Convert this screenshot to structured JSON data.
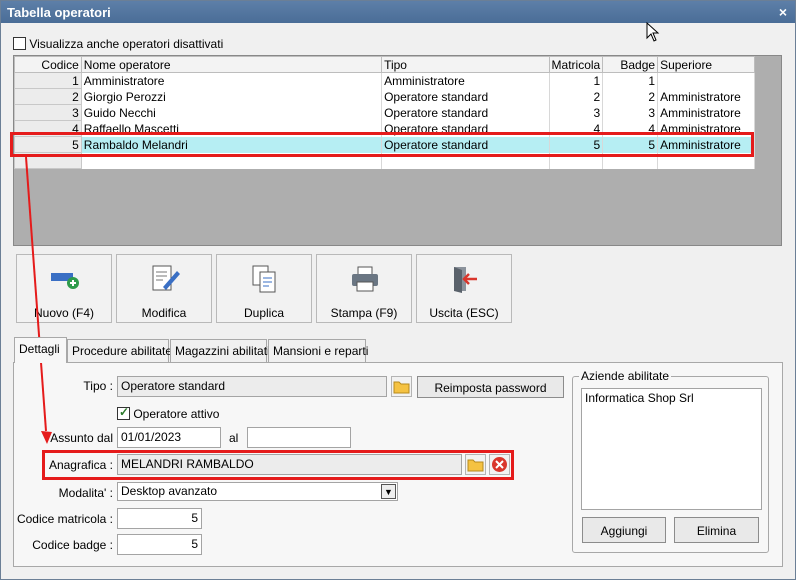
{
  "window": {
    "title": "Tabella operatori",
    "close_glyph": "×"
  },
  "show_disabled": {
    "label": "Visualizza anche operatori disattivati",
    "checked": false
  },
  "table": {
    "columns": [
      "Codice",
      "Nome operatore",
      "Tipo",
      "Matricola",
      "Badge",
      "Superiore"
    ],
    "rows": [
      {
        "codice": "1",
        "nome": "Amministratore",
        "tipo": "Amministratore",
        "matricola": "1",
        "badge": "1",
        "superiore": ""
      },
      {
        "codice": "2",
        "nome": "Giorgio Perozzi",
        "tipo": "Operatore standard",
        "matricola": "2",
        "badge": "2",
        "superiore": "Amministratore"
      },
      {
        "codice": "3",
        "nome": "Guido Necchi",
        "tipo": "Operatore standard",
        "matricola": "3",
        "badge": "3",
        "superiore": "Amministratore"
      },
      {
        "codice": "4",
        "nome": "Raffaello Mascetti",
        "tipo": "Operatore standard",
        "matricola": "4",
        "badge": "4",
        "superiore": "Amministratore"
      },
      {
        "codice": "5",
        "nome": "Rambaldo Melandri",
        "tipo": "Operatore standard",
        "matricola": "5",
        "badge": "5",
        "superiore": "Amministratore"
      }
    ],
    "selected_row": 5
  },
  "toolbar": {
    "nuovo": "Nuovo (F4)",
    "modifica": "Modifica",
    "duplica": "Duplica",
    "stampa": "Stampa (F9)",
    "uscita": "Uscita (ESC)"
  },
  "tabs": [
    "Dettagli",
    "Procedure abilitate",
    "Magazzini abilitati",
    "Mansioni e reparti"
  ],
  "details": {
    "tipo_label": "Tipo :",
    "tipo_value": "Operatore standard",
    "reset_password": "Reimposta password",
    "attivo_label": "Operatore attivo",
    "attivo_checked": true,
    "assunto_label": "Assunto dal",
    "assunto_value": "01/01/2023",
    "al_label": "al",
    "al_value": "",
    "anagrafica_label": "Anagrafica :",
    "anagrafica_value": "MELANDRI RAMBALDO",
    "modalita_label": "Modalita' :",
    "modalita_value": "Desktop avanzato",
    "matricola_label": "Codice matricola :",
    "matricola_value": "5",
    "badge_label": "Codice badge :",
    "badge_value": "5"
  },
  "aziende": {
    "title": "Aziende abilitate",
    "items": [
      "Informatica Shop Srl"
    ],
    "add": "Aggiungi",
    "remove": "Elimina"
  },
  "colors": {
    "titlebar": "#4f739c",
    "selection": "#b6eef3",
    "highlight": "#e51b1b"
  }
}
